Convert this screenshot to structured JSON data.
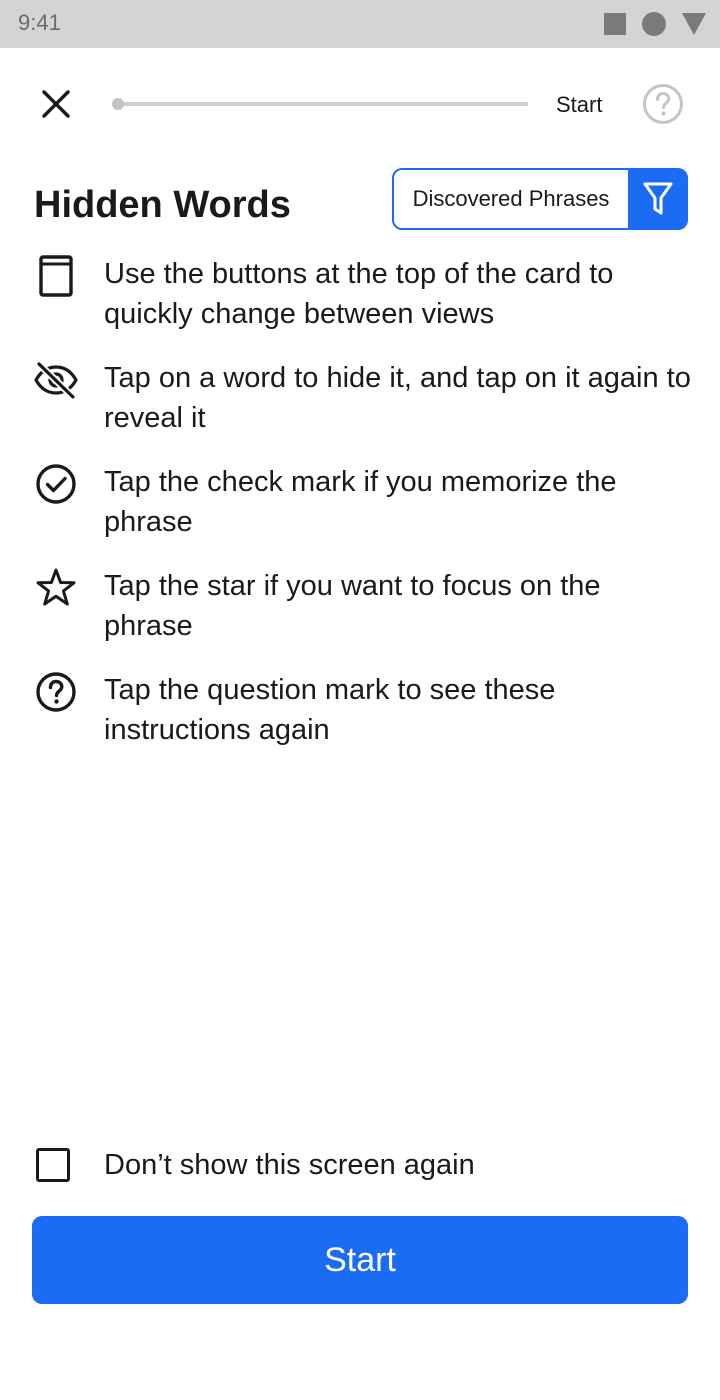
{
  "status_bar": {
    "time": "9:41",
    "icons": [
      "signal-square-icon",
      "wifi-circle-icon",
      "battery-triangle-icon"
    ]
  },
  "top_bar": {
    "close_icon": "close-icon",
    "progress": 0,
    "start_label": "Start",
    "help_icon": "help-icon"
  },
  "header": {
    "title": "Hidden Words",
    "filter_label": "Discovered Phrases",
    "filter_icon": "filter-icon"
  },
  "instructions": [
    {
      "icon": "card-icon",
      "text": "Use the buttons at the top of the card to quickly change between views"
    },
    {
      "icon": "eye-off-icon",
      "text": "Tap on a word to hide it, and tap on it again to reveal it"
    },
    {
      "icon": "check-circle-icon",
      "text": "Tap the check mark if you memorize the phrase"
    },
    {
      "icon": "star-icon",
      "text": "Tap the star if you want to focus on the phrase"
    },
    {
      "icon": "question-circle-icon",
      "text": "Tap the question mark to see these instructions again"
    }
  ],
  "footer": {
    "dont_show_label": "Don’t show this screen again",
    "dont_show_checked": false,
    "start_button": "Start"
  },
  "colors": {
    "accent": "#1a6cf5",
    "text": "#1a1a1a",
    "status_bar_bg": "#d4d4d4"
  }
}
